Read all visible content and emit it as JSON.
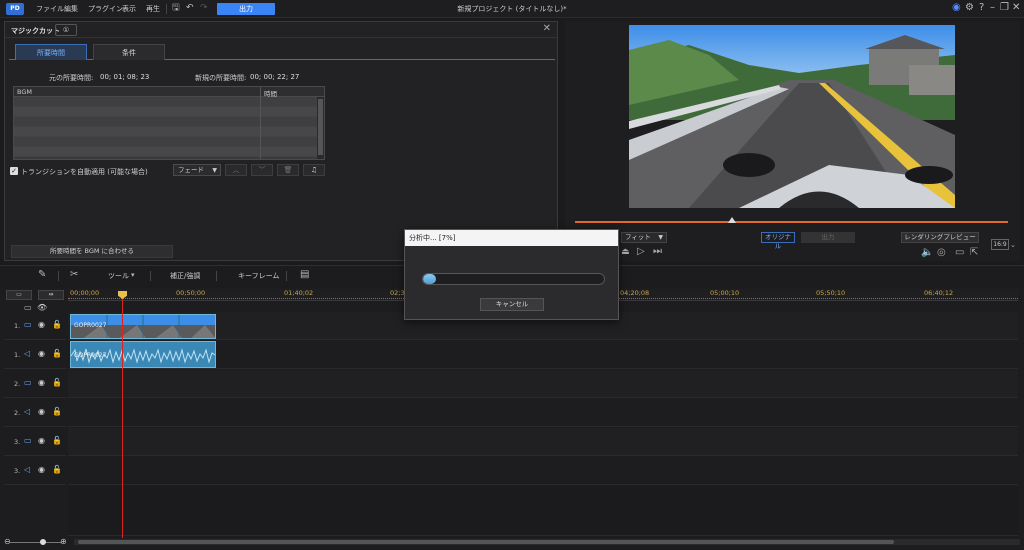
{
  "menubar": {
    "logo": "PD",
    "items": [
      "ファイル",
      "編集",
      "プラグイン",
      "表示",
      "再生"
    ],
    "output_label": "出力",
    "title": "新規プロジェクト (タイトルなし)*"
  },
  "magic_panel": {
    "title": "マジックカット",
    "info_tab": "①",
    "tabs": [
      "所要時間",
      "条件"
    ],
    "original_duration_label": "元の所要時間:",
    "original_duration_value": "00; 01; 08; 23",
    "new_duration_label": "新規の所要時間:",
    "new_duration_value": "00; 00; 22; 27",
    "table_headers": [
      "BGM",
      "時間"
    ],
    "auto_transition_label": "トランジションを自動適用 (可能な場合)",
    "fade_option": "フェード",
    "fit_bgm_button": "所要時間を BGM に合わせる"
  },
  "preview": {
    "fit_option": "フィット",
    "original_label": "オリジナル",
    "output_label": "出力",
    "render_preview_label": "レンダリングプレビュー",
    "aspect_ratio": "16:9"
  },
  "toolbar": {
    "tools_label": "ツール",
    "fix_enhance_label": "補正/強調",
    "keyframe_label": "キーフレーム"
  },
  "timeline": {
    "ruler_ticks": [
      "00;00;00",
      "00;50;00",
      "01;40;02",
      "02;3",
      "04;20;08",
      "05;00;10",
      "05;50;10",
      "06;40;12"
    ],
    "tracks": [
      {
        "num": "1.",
        "kind": "video"
      },
      {
        "num": "1.",
        "kind": "audio"
      },
      {
        "num": "2.",
        "kind": "video"
      },
      {
        "num": "2.",
        "kind": "audio"
      },
      {
        "num": "3.",
        "kind": "video"
      },
      {
        "num": "3.",
        "kind": "audio"
      }
    ],
    "clip_name": "GOPR0027"
  },
  "dialog": {
    "title": "分析中... [7%]",
    "progress": 0.07,
    "cancel_label": "キャンセル"
  }
}
